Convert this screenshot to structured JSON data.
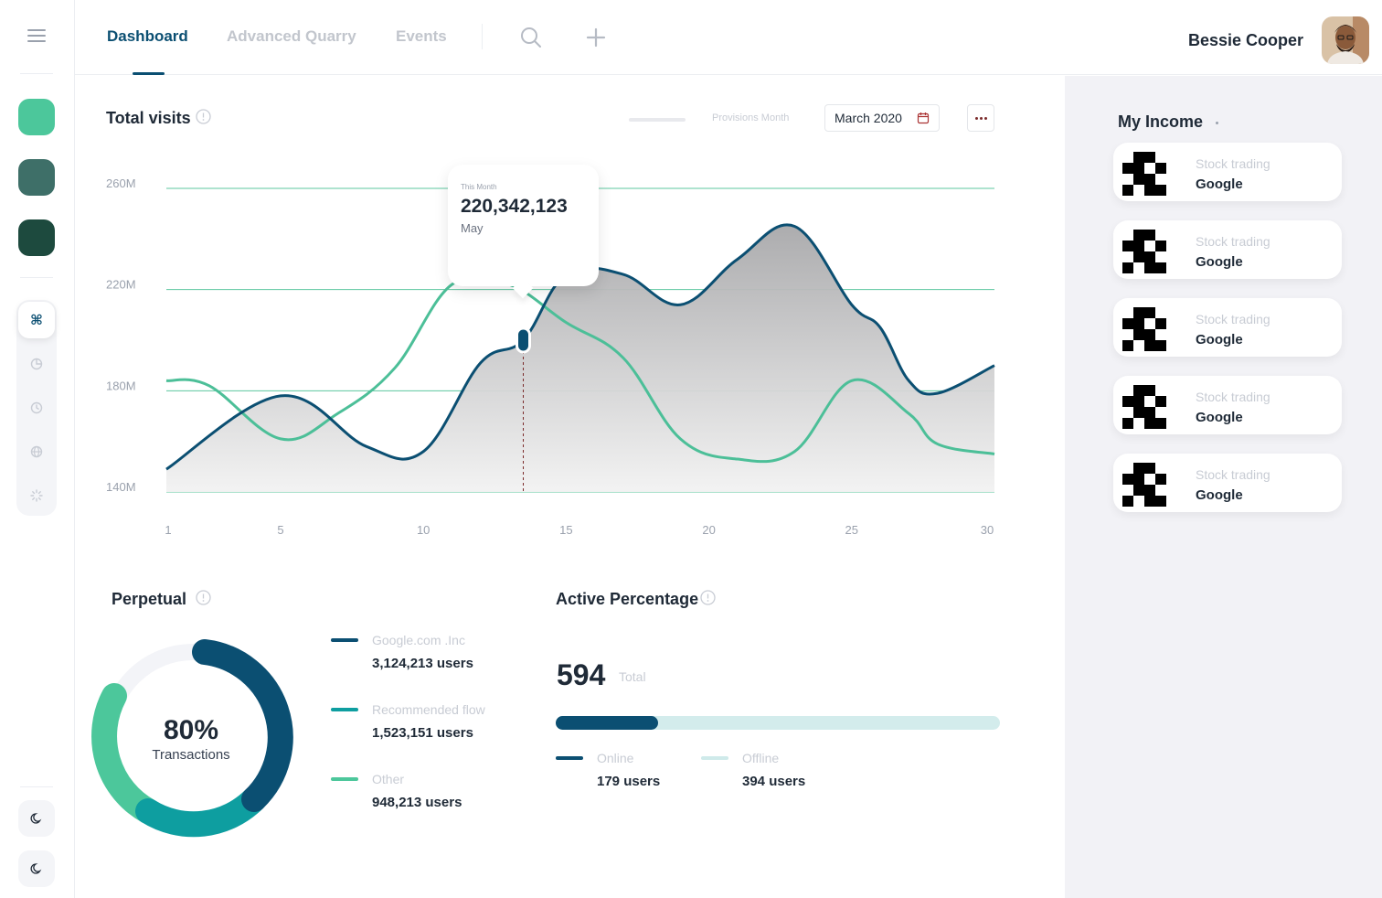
{
  "nav": {
    "tabs": [
      {
        "label": "Dashboard",
        "active": true
      },
      {
        "label": "Advanced Quarry",
        "active": false
      },
      {
        "label": "Events",
        "active": false
      }
    ],
    "icons": [
      "search-icon",
      "plus-icon"
    ]
  },
  "user": {
    "name": "Bessie Cooper"
  },
  "sidebar": {
    "apps": [
      {
        "color": "#4cc79b"
      },
      {
        "color": "#3e6f68"
      },
      {
        "color": "#1d4a3e"
      }
    ],
    "tools": [
      "command-icon",
      "pie-chart-icon",
      "clock-icon",
      "globe-icon",
      "loader-icon"
    ],
    "bottom": [
      "moon-icon",
      "moon-icon"
    ]
  },
  "visits": {
    "title": "Total visits",
    "legend_label": "Provisions Month",
    "date": "March 2020",
    "tooltip": {
      "label": "This Month",
      "value": "220,342,123",
      "month": "May"
    }
  },
  "chart_data": {
    "type": "line",
    "title": "Total visits",
    "y_ticks": [
      "140M",
      "180M",
      "220M",
      "260M"
    ],
    "x_ticks": [
      "1",
      "5",
      "10",
      "15",
      "20",
      "25",
      "30"
    ],
    "ylim": [
      140,
      260
    ],
    "xlim": [
      1,
      30
    ],
    "grid": true,
    "series": [
      {
        "color": "#0b4f72",
        "fill": true,
        "x": [
          1,
          5,
          8,
          10,
          12,
          13.5,
          15,
          17,
          19,
          21,
          23,
          25,
          26,
          27,
          28,
          30
        ],
        "y": [
          149,
          178,
          158,
          156,
          191,
          200,
          226,
          226,
          214,
          232,
          245,
          214,
          205,
          184,
          179,
          190
        ]
      },
      {
        "color": "#4cbf98",
        "fill": false,
        "x": [
          1,
          2.5,
          5,
          7,
          9,
          11,
          13,
          15,
          17,
          19,
          21,
          23,
          25,
          27,
          28,
          30
        ],
        "y": [
          184,
          182,
          161,
          171,
          189,
          222,
          222,
          207,
          193,
          161,
          153,
          156,
          184,
          171,
          159,
          155
        ]
      }
    ],
    "marker_x": 13.5
  },
  "perpetual": {
    "title": "Perpetual",
    "percent": "80%",
    "subtitle": "Transactions",
    "segments": [
      {
        "name": "Google.com .Inc",
        "value": "3,124,213 users",
        "color": "#0b4f72"
      },
      {
        "name": "Recommended flow",
        "value": "1,523,151 users",
        "color": "#0e9ea0"
      },
      {
        "name": "Other",
        "value": "948,213 users",
        "color": "#4cc79b"
      }
    ]
  },
  "active": {
    "title": "Active Percentage",
    "total": "594",
    "total_label": "Total",
    "online_fraction": 0.23,
    "online": {
      "name": "Online",
      "value": "179 users",
      "color": "#0b4f72"
    },
    "offline": {
      "name": "Offline",
      "value": "394 users",
      "color": "#cfeaea"
    }
  },
  "income": {
    "title": "My Income",
    "items": [
      {
        "sub": "Stock trading",
        "name": "Google"
      },
      {
        "sub": "Stock trading",
        "name": "Google"
      },
      {
        "sub": "Stock trading",
        "name": "Google"
      },
      {
        "sub": "Stock trading",
        "name": "Google"
      },
      {
        "sub": "Stock trading",
        "name": "Google"
      }
    ]
  }
}
